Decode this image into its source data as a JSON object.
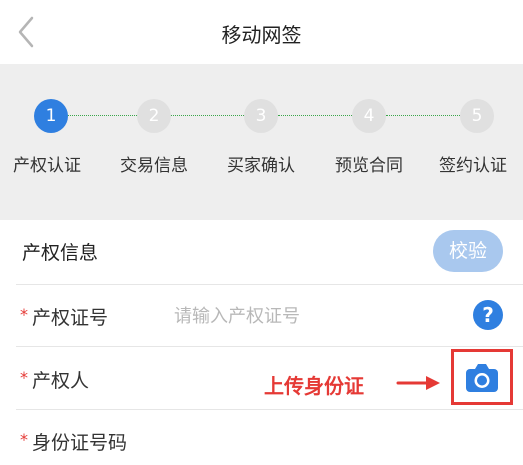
{
  "nav": {
    "back_icon": "chevron-left-icon",
    "title": "移动网签"
  },
  "steps": [
    {
      "number": "1",
      "label": "产权认证",
      "active": true
    },
    {
      "number": "2",
      "label": "交易信息",
      "active": false
    },
    {
      "number": "3",
      "label": "买家确认",
      "active": false
    },
    {
      "number": "4",
      "label": "预览合同",
      "active": false
    },
    {
      "number": "5",
      "label": "签约认证",
      "active": false
    }
  ],
  "section": {
    "title": "产权信息",
    "verify_label": "校验"
  },
  "form": {
    "required_mark": "*",
    "cert_number": {
      "label": "产权证号",
      "placeholder": "请输入产权证号",
      "value": "",
      "help_icon": "question-icon",
      "help_glyph": "?"
    },
    "owner": {
      "label": "产权人",
      "upload_hint": "上传身份证",
      "camera_icon": "camera-icon"
    },
    "id_number": {
      "label": "身份证号码"
    }
  },
  "colors": {
    "accent": "#2f7fe0",
    "verify_button": "#a9c8ee",
    "annotation": "#e53935",
    "step_inactive": "#e0e0e0",
    "step_connector": "#3aa64a",
    "panel_bg": "#eeeeee"
  }
}
